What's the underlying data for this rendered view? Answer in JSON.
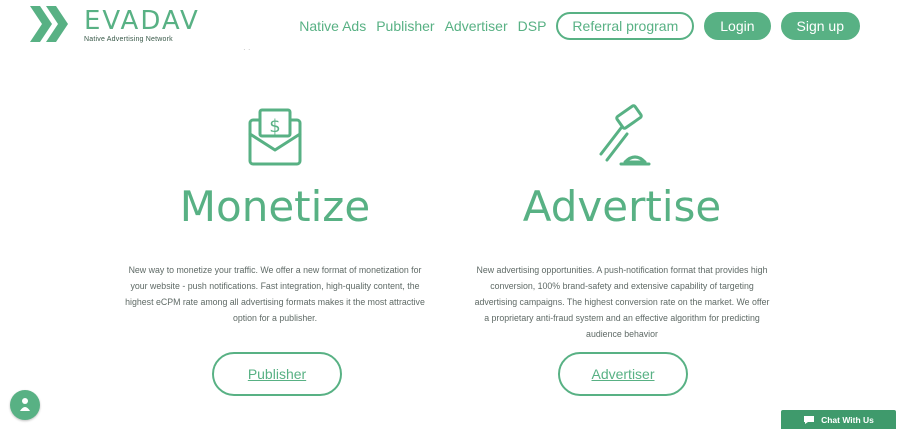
{
  "colors": {
    "accent": "#58b184",
    "accent_dark": "#3f9a6c"
  },
  "header": {
    "brand": "EVADAV",
    "tagline": "Native Advertising Network",
    "nav": {
      "native_ads": "Native Ads",
      "publisher": "Publisher",
      "advertiser": "Advertiser",
      "dsp": "DSP",
      "referral": "Referral program",
      "login": "Login",
      "signup": "Sign up"
    },
    "tiny_text": "· ·"
  },
  "left": {
    "icon": "money-envelope-icon",
    "title": "Monetize",
    "description": "New way to monetize your traffic. We offer a new format of monetization for your website - push notifications. Fast integration, high-quality content, the highest eCPM rate among all advertising formats makes it the most attractive option for a publisher.",
    "button": "Publisher"
  },
  "right": {
    "icon": "gavel-icon",
    "title": "Advertise",
    "description": "New advertising opportunities. A push-notification format that provides high conversion, 100% brand-safety and extensive capability of targeting advertising campaigns. The highest conversion rate on the market. We offer a proprietary anti-fraud system and an effective algorithm for predicting audience behavior",
    "button": "Advertiser"
  },
  "widgets": {
    "chat_label": "Chat With Us",
    "fab_icon": "person-icon",
    "chat_icon": "chat-bubble-icon"
  }
}
